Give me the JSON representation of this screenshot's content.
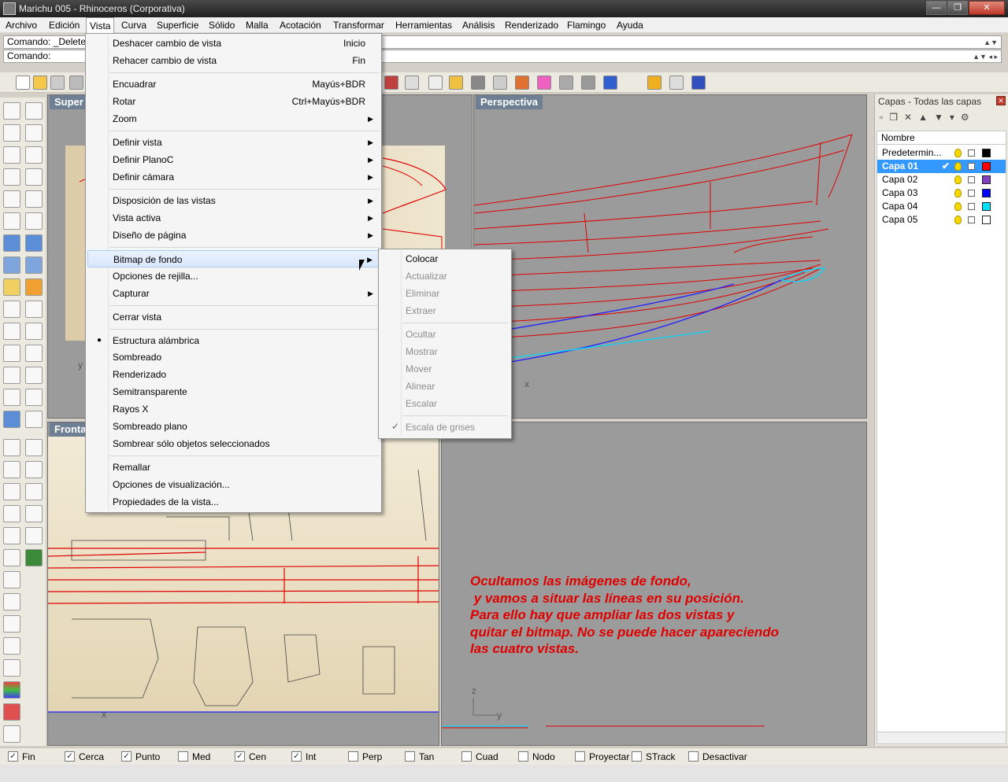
{
  "window": {
    "title": "Marichu 005 - Rhinoceros (Corporativa)",
    "min_label": "—",
    "max_label": "❐",
    "close_label": "✕"
  },
  "menubar": [
    "Archivo",
    "Edición",
    "Vista",
    "Curva",
    "Superficie",
    "Sólido",
    "Malla",
    "Acotación",
    "Transformar",
    "Herramientas",
    "Análisis",
    "Renderizado",
    "Flamingo",
    "Ayuda"
  ],
  "command": {
    "history_line": "Comando: _Delete",
    "prompt_label": "Comando:"
  },
  "viewports": {
    "top": "Super",
    "perspective": "Perspectiva",
    "front": "Fronta"
  },
  "axes": {
    "y": "y",
    "x": "x",
    "z": "z"
  },
  "note": "Ocultamos las imágenes de fondo,\n y vamos a situar las líneas en su posición.\nPara ello hay que ampliar las dos vistas y\nquitar el bitmap. No se puede hacer apareciendo\nlas cuatro vistas.",
  "vista_menu": [
    {
      "label": "Deshacer cambio de vista",
      "shortcut": "Inicio"
    },
    {
      "label": "Rehacer cambio de vista",
      "shortcut": "Fin"
    },
    {
      "label": "Encuadrar",
      "shortcut": "Mayús+BDR"
    },
    {
      "label": "Rotar",
      "shortcut": "Ctrl+Mayús+BDR"
    },
    {
      "label": "Zoom",
      "submenu": true
    },
    {
      "label": "Definir vista",
      "submenu": true
    },
    {
      "label": "Definir PlanoC",
      "submenu": true
    },
    {
      "label": "Definir cámara",
      "submenu": true
    },
    {
      "label": "Disposición de las vistas",
      "submenu": true
    },
    {
      "label": "Vista activa",
      "submenu": true
    },
    {
      "label": "Diseño de página",
      "submenu": true
    },
    {
      "label": "Bitmap de fondo",
      "submenu": true,
      "highlighted": true
    },
    {
      "label": "Opciones de rejilla..."
    },
    {
      "label": "Capturar",
      "submenu": true
    },
    {
      "label": "Cerrar vista"
    },
    {
      "label": "Estructura alámbrica",
      "selected": true
    },
    {
      "label": "Sombreado"
    },
    {
      "label": "Renderizado"
    },
    {
      "label": "Semitransparente"
    },
    {
      "label": "Rayos X"
    },
    {
      "label": "Sombreado plano"
    },
    {
      "label": "Sombrear sólo objetos seleccionados"
    },
    {
      "label": "Remallar"
    },
    {
      "label": "Opciones de visualización..."
    },
    {
      "label": "Propiedades de la vista..."
    }
  ],
  "bitmap_submenu": [
    {
      "label": "Colocar",
      "enabled": true
    },
    {
      "label": "Actualizar",
      "enabled": false
    },
    {
      "label": "Eliminar",
      "enabled": false
    },
    {
      "label": "Extraer",
      "enabled": false
    },
    {
      "label": "Ocultar",
      "enabled": false
    },
    {
      "label": "Mostrar",
      "enabled": false
    },
    {
      "label": "Mover",
      "enabled": false
    },
    {
      "label": "Alinear",
      "enabled": false
    },
    {
      "label": "Escalar",
      "enabled": false
    },
    {
      "label": "Escala de grises",
      "enabled": false,
      "checked": true
    }
  ],
  "layers_panel": {
    "title": "Capas - Todas las capas",
    "column_name": "Nombre",
    "current_mark": "✔",
    "layers": [
      {
        "name": "Predetermin...",
        "color": "#000000",
        "selected": false
      },
      {
        "name": "Capa 01",
        "color": "#ff0000",
        "selected": true
      },
      {
        "name": "Capa 02",
        "color": "#8040c0",
        "selected": false
      },
      {
        "name": "Capa 03",
        "color": "#0000ff",
        "selected": false
      },
      {
        "name": "Capa 04",
        "color": "#00e0ff",
        "selected": false
      },
      {
        "name": "Capa 05",
        "color": "#ffffff",
        "selected": false
      }
    ]
  },
  "osnaps": [
    {
      "label": "Fin",
      "checked": true
    },
    {
      "label": "Cerca",
      "checked": true
    },
    {
      "label": "Punto",
      "checked": true
    },
    {
      "label": "Med",
      "checked": false
    },
    {
      "label": "Cen",
      "checked": true
    },
    {
      "label": "Int",
      "checked": true
    },
    {
      "label": "Perp",
      "checked": false
    },
    {
      "label": "Tan",
      "checked": false
    },
    {
      "label": "Cuad",
      "checked": false
    },
    {
      "label": "Nodo",
      "checked": false
    },
    {
      "label": "Proyectar",
      "checked": false
    },
    {
      "label": "STrack",
      "checked": false
    },
    {
      "label": "Desactivar",
      "checked": false
    }
  ],
  "colors": {
    "curve_red": "#e00000",
    "curve_blue": "#2020ff",
    "curve_cyan": "#00d8ff",
    "menu_highlight": "#d9e7fb",
    "viewport_bg": "#9b9b9b"
  }
}
